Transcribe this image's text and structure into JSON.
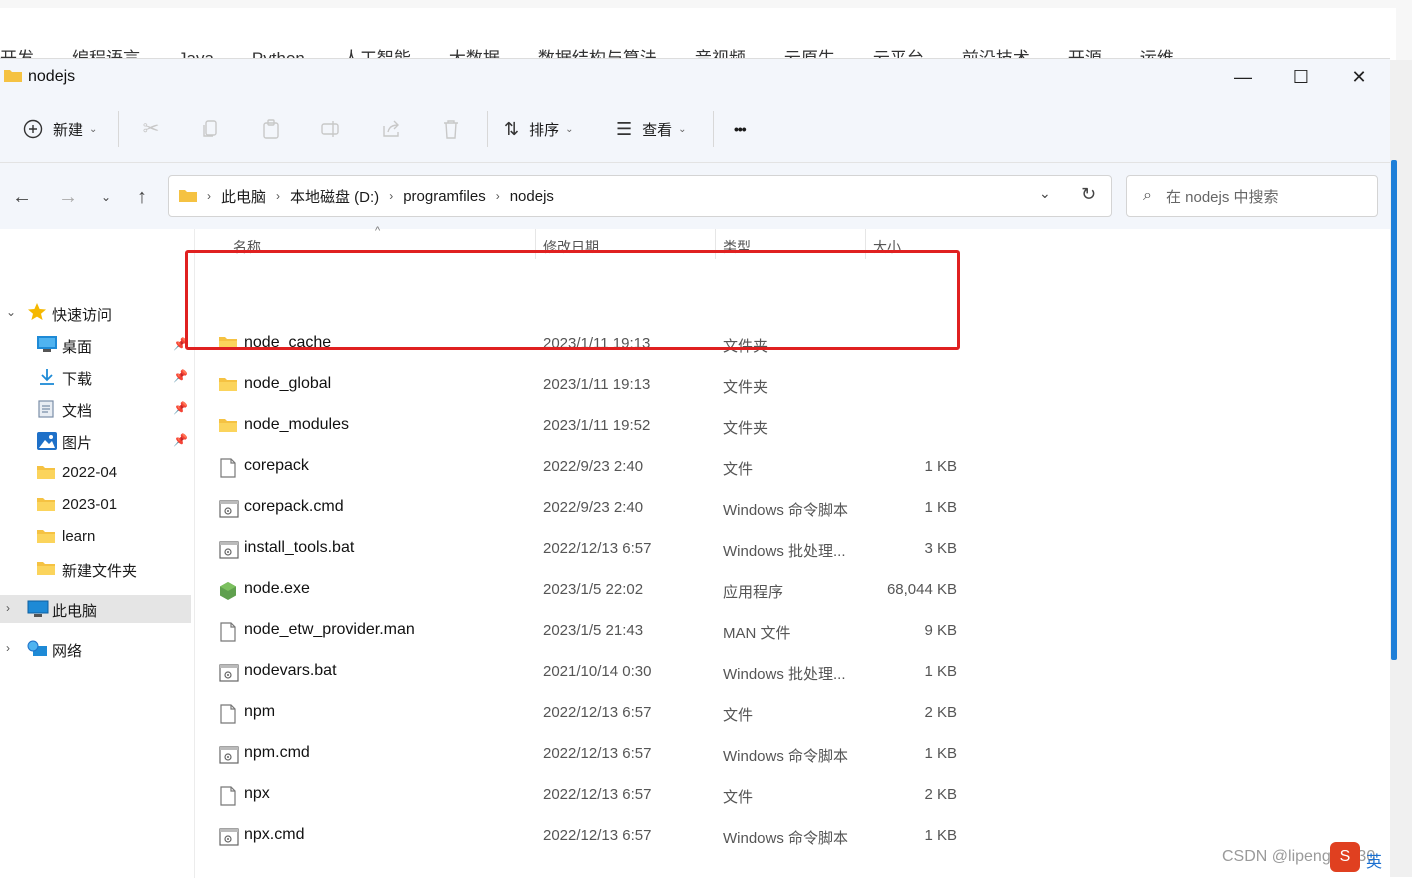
{
  "background": {
    "nav_items": [
      "开发",
      "编程语言",
      "Java",
      "Python",
      "人工智能",
      "大数据",
      "数据结构与算法",
      "音视频",
      "云原生",
      "云平台",
      "前沿技术",
      "开源",
      "运维"
    ]
  },
  "window": {
    "title": "nodejs",
    "minimize": "—",
    "maximize": "☐",
    "close": "✕"
  },
  "toolbar": {
    "new_label": "新建",
    "sort_label": "排序",
    "view_label": "查看",
    "more_label": "•••"
  },
  "address": {
    "crumbs": [
      "此电脑",
      "本地磁盘 (D:)",
      "programfiles",
      "nodejs"
    ],
    "search_placeholder": "在 nodejs 中搜索"
  },
  "sidebar": {
    "quick_access": "快速访问",
    "items": [
      {
        "label": "桌面",
        "icon": "desktop-icon",
        "pinned": true
      },
      {
        "label": "下载",
        "icon": "download-icon",
        "pinned": true
      },
      {
        "label": "文档",
        "icon": "document-icon",
        "pinned": true
      },
      {
        "label": "图片",
        "icon": "picture-icon",
        "pinned": true
      },
      {
        "label": "2022-04",
        "icon": "folder-icon",
        "pinned": false
      },
      {
        "label": "2023-01",
        "icon": "folder-icon",
        "pinned": false
      },
      {
        "label": "learn",
        "icon": "folder-icon",
        "pinned": false
      },
      {
        "label": "新建文件夹",
        "icon": "folder-icon",
        "pinned": false
      }
    ],
    "this_pc": "此电脑",
    "network": "网络"
  },
  "columns": {
    "name": "名称",
    "date": "修改日期",
    "type": "类型",
    "size": "大小"
  },
  "files": [
    {
      "name": "node_cache",
      "date": "2023/1/11 19:13",
      "type": "文件夹",
      "size": "",
      "icon": "folder-icon"
    },
    {
      "name": "node_global",
      "date": "2023/1/11 19:13",
      "type": "文件夹",
      "size": "",
      "icon": "folder-icon"
    },
    {
      "name": "node_modules",
      "date": "2023/1/11 19:52",
      "type": "文件夹",
      "size": "",
      "icon": "folder-icon"
    },
    {
      "name": "corepack",
      "date": "2022/9/23 2:40",
      "type": "文件",
      "size": "1 KB",
      "icon": "file-icon"
    },
    {
      "name": "corepack.cmd",
      "date": "2022/9/23 2:40",
      "type": "Windows 命令脚本",
      "size": "1 KB",
      "icon": "script-icon"
    },
    {
      "name": "install_tools.bat",
      "date": "2022/12/13 6:57",
      "type": "Windows 批处理...",
      "size": "3 KB",
      "icon": "script-icon"
    },
    {
      "name": "node.exe",
      "date": "2023/1/5 22:02",
      "type": "应用程序",
      "size": "68,044 KB",
      "icon": "node-exe-icon"
    },
    {
      "name": "node_etw_provider.man",
      "date": "2023/1/5 21:43",
      "type": "MAN 文件",
      "size": "9 KB",
      "icon": "file-icon"
    },
    {
      "name": "nodevars.bat",
      "date": "2021/10/14 0:30",
      "type": "Windows 批处理...",
      "size": "1 KB",
      "icon": "script-icon"
    },
    {
      "name": "npm",
      "date": "2022/12/13 6:57",
      "type": "文件",
      "size": "2 KB",
      "icon": "file-icon"
    },
    {
      "name": "npm.cmd",
      "date": "2022/12/13 6:57",
      "type": "Windows 命令脚本",
      "size": "1 KB",
      "icon": "script-icon"
    },
    {
      "name": "npx",
      "date": "2022/12/13 6:57",
      "type": "文件",
      "size": "2 KB",
      "icon": "file-icon"
    },
    {
      "name": "npx.cmd",
      "date": "2022/12/13 6:57",
      "type": "Windows 命令脚本",
      "size": "1 KB",
      "icon": "script-icon"
    }
  ],
  "overlay": {
    "watermark": "CSDN @lipeng19930",
    "ime_logo": "S",
    "ime_lang": "英"
  },
  "colors": {
    "highlight": "#e02020",
    "folder": "#f5c242",
    "selection": "#e5e5e5"
  }
}
